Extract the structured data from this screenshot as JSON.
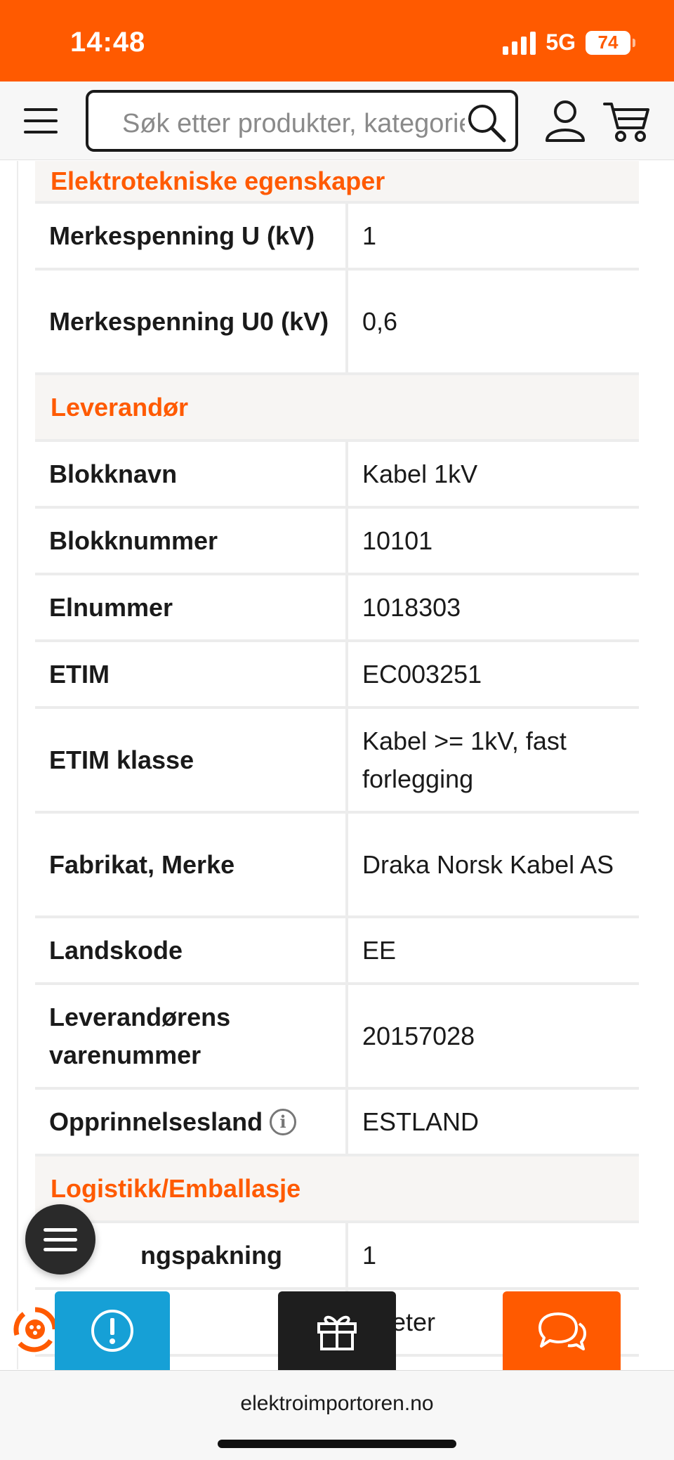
{
  "status_bar": {
    "time": "14:48",
    "network": "5G",
    "battery": "74"
  },
  "header": {
    "search_placeholder": "Søk etter produkter, kategorier"
  },
  "sections": [
    {
      "title": "Elektrotekniske egenskaper",
      "rows": [
        {
          "key": "Merkespenning U (kV)",
          "value": "1"
        },
        {
          "key": "Merkespenning U0 (kV)",
          "value": "0,6"
        }
      ]
    },
    {
      "title": "Leverandør",
      "rows": [
        {
          "key": "Blokknavn",
          "value": "Kabel 1kV"
        },
        {
          "key": "Blokknummer",
          "value": "10101"
        },
        {
          "key": "Elnummer",
          "value": "1018303"
        },
        {
          "key": "ETIM",
          "value": "EC003251"
        },
        {
          "key": "ETIM klasse",
          "value": "Kabel >= 1kV, fast forlegging"
        },
        {
          "key": "Fabrikat, Merke",
          "value": "Draka Norsk Kabel AS"
        },
        {
          "key": "Landskode",
          "value": "EE"
        },
        {
          "key": "Leverandørens varenummer",
          "value": "20157028"
        },
        {
          "key": "Opprinnelsesland",
          "value": "ESTLAND",
          "info_icon": "info-icon"
        }
      ]
    },
    {
      "title": "Logistikk/Emballasje",
      "rows": [
        {
          "key": "ngspakning",
          "value": "1"
        },
        {
          "key": "",
          "value": "eter"
        }
      ]
    }
  ],
  "browser": {
    "url": "elektroimportoren.no"
  },
  "colors": {
    "brand": "#ff5a00",
    "info_blue": "#16a0d6",
    "dark": "#1e1e1e"
  },
  "icons": [
    "hamburger-menu-icon",
    "search-icon",
    "user-icon",
    "cart-icon",
    "info-icon",
    "fab-menu-icon",
    "warning-icon",
    "gift-icon",
    "chat-icon",
    "widget-badge-icon"
  ]
}
